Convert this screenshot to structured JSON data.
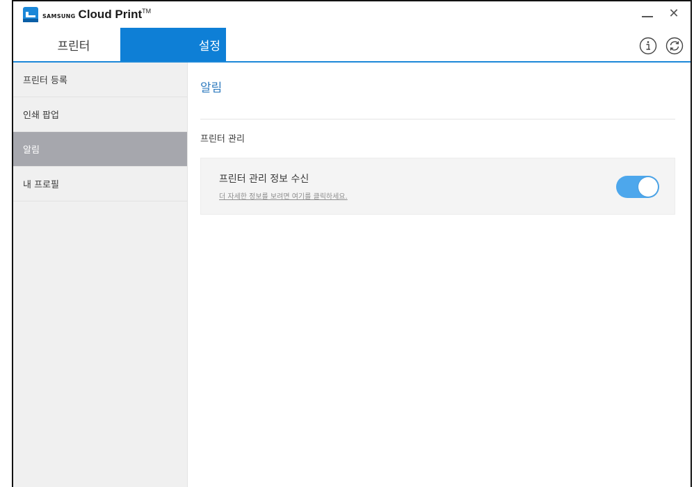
{
  "app": {
    "brand_small": "SAMSUNG",
    "brand_name": "Cloud Print",
    "brand_tm": "TM",
    "brand_color": "#1b87d8"
  },
  "window_controls": {
    "minimize_icon": "minimize-icon",
    "close_symbol": "✕"
  },
  "tabs": [
    {
      "label": "프린터",
      "active": false
    },
    {
      "label": "설정",
      "active": true
    }
  ],
  "toolbar_icons": [
    "info-icon",
    "refresh-icon"
  ],
  "sidebar": {
    "items": [
      {
        "label": "프린터 등록",
        "active": false
      },
      {
        "label": "인쇄 팝업",
        "active": false
      },
      {
        "label": "알림",
        "active": true
      },
      {
        "label": "내 프로필",
        "active": false
      }
    ]
  },
  "main": {
    "title": "알림",
    "section_title": "프린터 관리",
    "card": {
      "title": "프린터 관리 정보 수신",
      "link": "더 자세한 정보를 보려면 여기를 클릭하세요.",
      "toggle_on": true
    }
  },
  "colors": {
    "accent": "#0e7fd6",
    "toggle_on": "#4da7ec",
    "sidebar_active": "#a6a7ad",
    "title_blue": "#2f7bbf"
  }
}
